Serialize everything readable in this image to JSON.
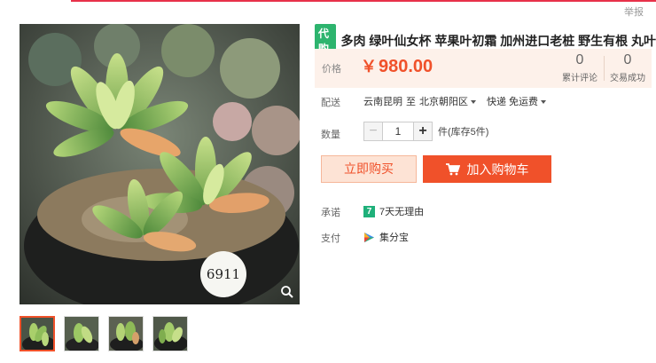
{
  "header": {
    "report_label": "举报"
  },
  "product": {
    "tag": "代购",
    "title": "多肉 绿叶仙女杯 苹果叶初霜 加州进口老桩 野生有根 丸叶",
    "image_label": "6911"
  },
  "price": {
    "label": "价格",
    "currency": "￥",
    "value": "980.00",
    "reviews_count": "0",
    "reviews_label": "累计评论",
    "trades_count": "0",
    "trades_label": "交易成功"
  },
  "delivery": {
    "label": "配送",
    "from": "云南昆明",
    "to_word": "至",
    "destination": "北京朝阳区",
    "method": "快递 免运费"
  },
  "quantity": {
    "label": "数量",
    "minus": "−",
    "value": "1",
    "plus": "+",
    "unit": "件(库存5件)"
  },
  "actions": {
    "buy_now": "立即购买",
    "add_cart": "加入购物车"
  },
  "promise": {
    "label": "承诺",
    "badge": "7",
    "text": "7天无理由"
  },
  "payment": {
    "label": "支付",
    "method": "集分宝"
  },
  "colors": {
    "accent": "#f0512a",
    "tag_green": "#2db46e",
    "price_bg": "#fdf1ea"
  },
  "icons": [
    "zoom-icon",
    "cart-icon",
    "seven-day-icon",
    "jifenbao-icon",
    "chevron-down-icon"
  ]
}
